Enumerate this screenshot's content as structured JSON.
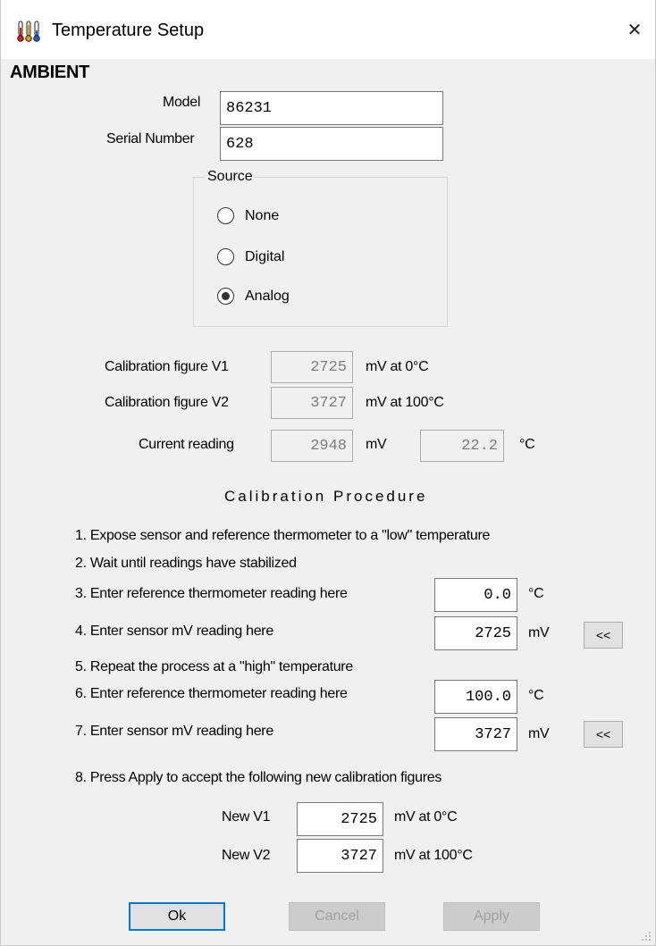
{
  "window": {
    "title": "Temperature Setup",
    "title_icon": "thermometers-icon",
    "close_icon": "close-icon",
    "close_glyph": "✕"
  },
  "heading": "AMBIENT",
  "model": {
    "label": "Model",
    "value": "86231"
  },
  "serial": {
    "label": "Serial Number",
    "value": "628"
  },
  "source": {
    "legend": "Source",
    "options": [
      {
        "label": "None",
        "selected": false
      },
      {
        "label": "Digital",
        "selected": false
      },
      {
        "label": "Analog",
        "selected": true
      }
    ]
  },
  "calibration": {
    "v1": {
      "label": "Calibration figure V1",
      "value": "2725",
      "unit": "mV at 0°C"
    },
    "v2": {
      "label": "Calibration figure V2",
      "value": "3727",
      "unit": "mV at 100°C"
    },
    "current": {
      "label": "Current reading",
      "mv_value": "2948",
      "mv_unit": "mV",
      "temp_value": "22.2",
      "temp_unit": "°C"
    }
  },
  "procedure": {
    "title": "Calibration Procedure",
    "steps": {
      "s1": "1. Expose sensor and reference thermometer to a \"low\" temperature",
      "s2": "2. Wait until readings have stabilized",
      "s3": "3. Enter reference thermometer reading here",
      "s4": "4. Enter sensor mV reading here",
      "s5": "5. Repeat the process at a \"high\" temperature",
      "s6": "6. Enter reference thermometer reading here",
      "s7": "7. Enter sensor mV reading here",
      "s8": "8. Press Apply to accept the following new calibration figures"
    },
    "low_temp": "0.0",
    "low_mv": "2725",
    "high_temp": "100.0",
    "high_mv": "3727",
    "unit_c": "°C",
    "unit_mv": "mV",
    "copy_button": "<<"
  },
  "new_figures": {
    "v1": {
      "label": "New V1",
      "value": "2725",
      "unit": "mV at 0°C"
    },
    "v2": {
      "label": "New V2",
      "value": "3727",
      "unit": "mV at 100°C"
    }
  },
  "buttons": {
    "ok": "Ok",
    "cancel": "Cancel",
    "apply": "Apply"
  },
  "colors": {
    "focus_border": "#0078d7",
    "disabled_text": "#a0a0a0"
  }
}
